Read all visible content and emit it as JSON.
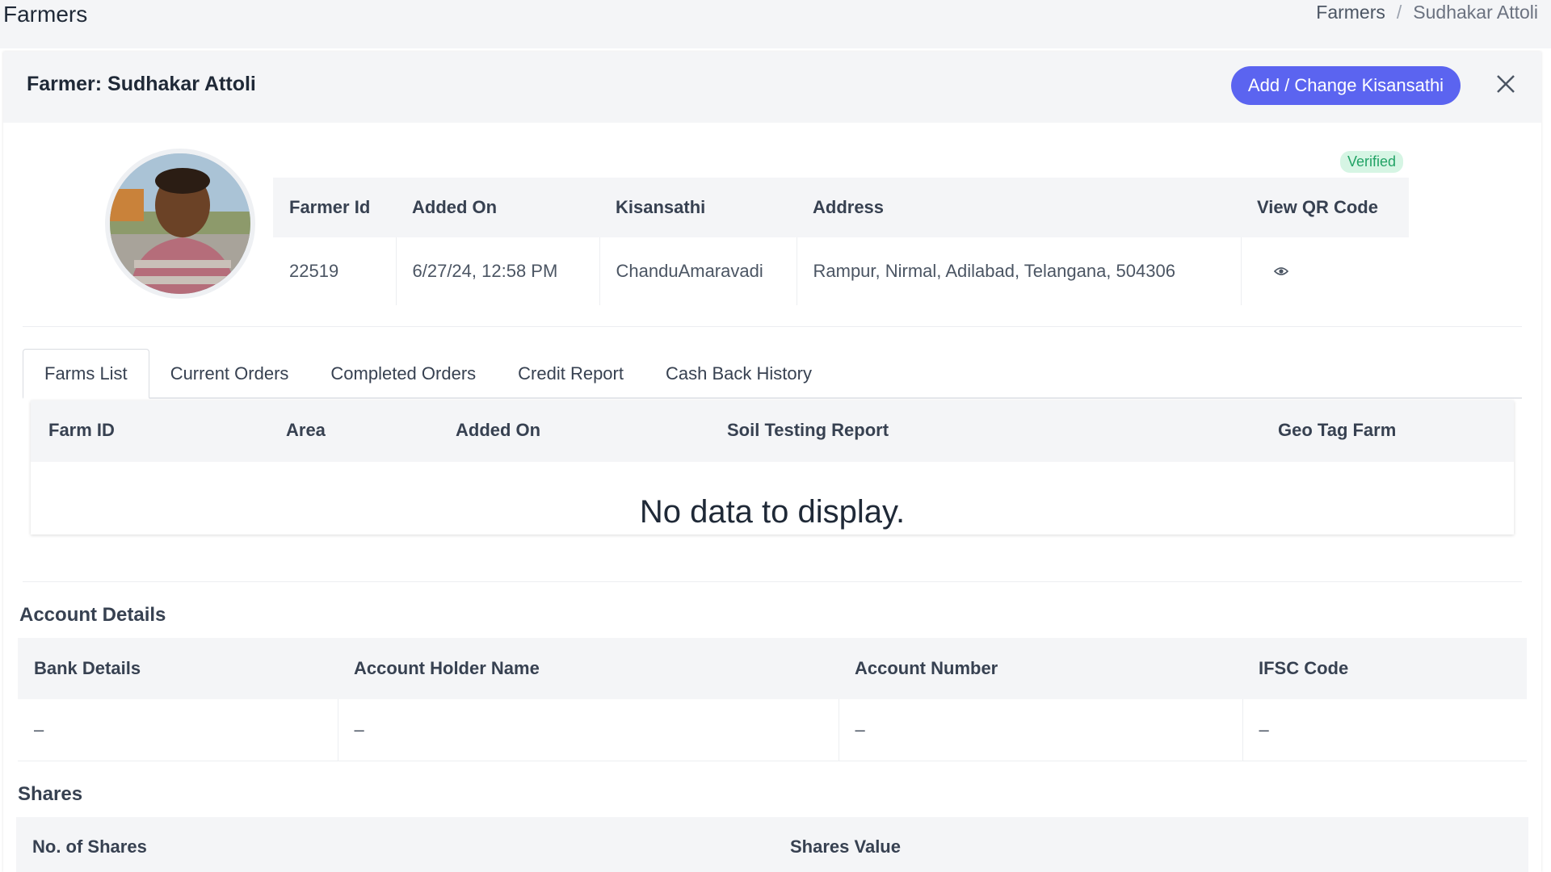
{
  "page": {
    "title": "Farmers"
  },
  "breadcrumb": {
    "items": [
      "Farmers",
      "Sudhakar Attoli"
    ],
    "separator": "/"
  },
  "card": {
    "title": "Farmer: Sudhakar Attoli",
    "primary_button": "Add / Change Kisansathi",
    "close_icon": "close-icon"
  },
  "profile": {
    "verified_badge": "Verified",
    "avatar_icon": "farmer-photo",
    "headers": [
      "Farmer Id",
      "Added On",
      "Kisansathi",
      "Address",
      "View QR Code"
    ],
    "values": [
      "22519",
      "6/27/24, 12:58 PM",
      "ChanduAmaravadi",
      "Rampur, Nirmal, Adilabad, Telangana, 504306"
    ],
    "qr_icon": "eye-icon"
  },
  "tabs": [
    "Farms List",
    "Current Orders",
    "Completed Orders",
    "Credit Report",
    "Cash Back History"
  ],
  "active_tab": "Farms List",
  "farms_table": {
    "headers": [
      "Farm ID",
      "Area",
      "Added On",
      "Soil Testing Report",
      "Geo Tag Farm"
    ],
    "empty_message": "No data to display."
  },
  "account": {
    "title": "Account Details",
    "headers": [
      "Bank Details",
      "Account Holder Name",
      "Account Number",
      "IFSC Code"
    ],
    "values": [
      "–",
      "–",
      "–",
      "–"
    ]
  },
  "shares": {
    "title": "Shares",
    "headers": [
      "No. of Shares",
      "Shares Value"
    ]
  },
  "colors": {
    "accent": "#5b64f0",
    "verified_bg": "#d6f5e4",
    "verified_text": "#22a366",
    "header_bg": "#f4f5f7"
  }
}
